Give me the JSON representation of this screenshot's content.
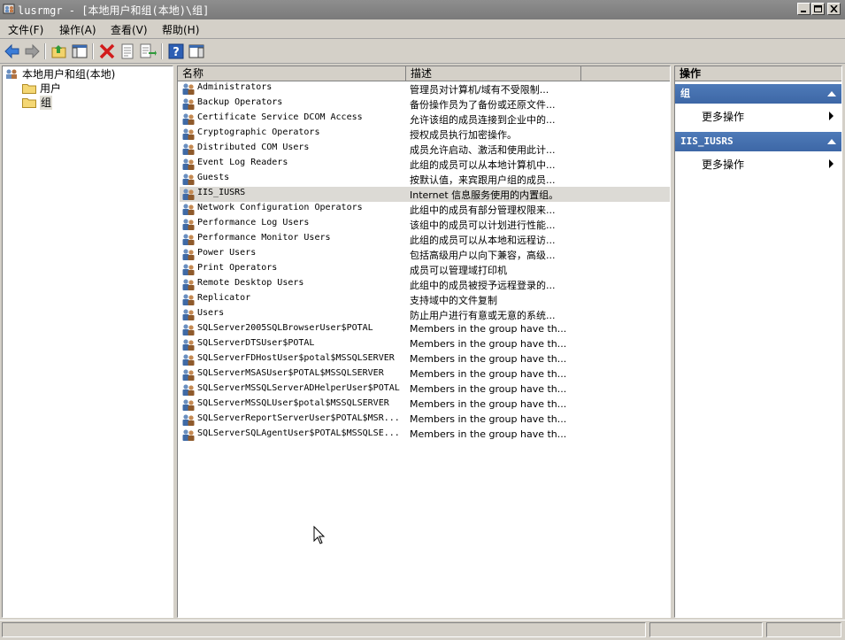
{
  "window": {
    "title": "lusrmgr - [本地用户和组(本地)\\组]"
  },
  "menu": {
    "file": "文件(F)",
    "action": "操作(A)",
    "view": "查看(V)",
    "help": "帮助(H)"
  },
  "tree": {
    "root": "本地用户和组(本地)",
    "users": "用户",
    "groups": "组"
  },
  "list": {
    "col_name": "名称",
    "col_desc": "描述",
    "rows": [
      {
        "name": "Administrators",
        "desc": "管理员对计算机/域有不受限制..."
      },
      {
        "name": "Backup Operators",
        "desc": "备份操作员为了备份或还原文件..."
      },
      {
        "name": "Certificate Service DCOM Access",
        "desc": "允许该组的成员连接到企业中的..."
      },
      {
        "name": "Cryptographic Operators",
        "desc": "授权成员执行加密操作。"
      },
      {
        "name": "Distributed COM Users",
        "desc": "成员允许启动、激活和使用此计..."
      },
      {
        "name": "Event Log Readers",
        "desc": "此组的成员可以从本地计算机中..."
      },
      {
        "name": "Guests",
        "desc": "按默认值，来宾跟用户组的成员..."
      },
      {
        "name": "IIS_IUSRS",
        "desc": "Internet 信息服务使用的内置组。"
      },
      {
        "name": "Network Configuration Operators",
        "desc": "此组中的成员有部分管理权限来..."
      },
      {
        "name": "Performance Log Users",
        "desc": "该组中的成员可以计划进行性能..."
      },
      {
        "name": "Performance Monitor Users",
        "desc": "此组的成员可以从本地和远程访..."
      },
      {
        "name": "Power Users",
        "desc": "包括高级用户以向下兼容，高级..."
      },
      {
        "name": "Print Operators",
        "desc": "成员可以管理域打印机"
      },
      {
        "name": "Remote Desktop Users",
        "desc": "此组中的成员被授予远程登录的..."
      },
      {
        "name": "Replicator",
        "desc": "支持域中的文件复制"
      },
      {
        "name": "Users",
        "desc": "防止用户进行有意或无意的系统..."
      },
      {
        "name": "SQLServer2005SQLBrowserUser$POTAL",
        "desc": "Members in the group have th..."
      },
      {
        "name": "SQLServerDTSUser$POTAL",
        "desc": "Members in the group have th..."
      },
      {
        "name": "SQLServerFDHostUser$potal$MSSQLSERVER",
        "desc": "Members in the group have th..."
      },
      {
        "name": "SQLServerMSASUser$POTAL$MSSQLSERVER",
        "desc": "Members in the group have th..."
      },
      {
        "name": "SQLServerMSSQLServerADHelperUser$POTAL",
        "desc": "Members in the group have th..."
      },
      {
        "name": "SQLServerMSSQLUser$potal$MSSQLSERVER",
        "desc": "Members in the group have th..."
      },
      {
        "name": "SQLServerReportServerUser$POTAL$MSR...",
        "desc": "Members in the group have th..."
      },
      {
        "name": "SQLServerSQLAgentUser$POTAL$MSSQLSE...",
        "desc": "Members in the group have th..."
      }
    ]
  },
  "actions": {
    "header": "操作",
    "section1": "组",
    "section1_more": "更多操作",
    "section2": "IIS_IUSRS",
    "section2_more": "更多操作"
  }
}
